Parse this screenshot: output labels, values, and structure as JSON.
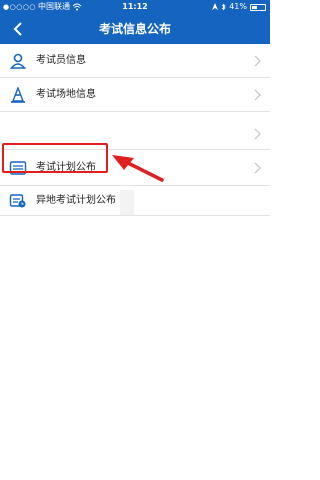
{
  "status_bar": {
    "signal": "●○○○○",
    "carrier": "中国联通",
    "time": "11:12",
    "battery": "41%",
    "battery_level": 0.41
  },
  "header": {
    "title": "考试信息公布"
  },
  "list": {
    "items": [
      {
        "label": "考试员信息",
        "icon": "person-icon"
      },
      {
        "label": "考试场地信息",
        "icon": "cone-icon"
      },
      {
        "label": "",
        "icon": ""
      },
      {
        "label": "考试计划公布",
        "icon": "calendar-list-icon"
      },
      {
        "label": "异地考试计划公布",
        "icon": "calendar-remote-icon"
      }
    ]
  },
  "colors": {
    "header_bg": "#1565c0",
    "highlight": "#e02020",
    "icon_blue": "#1565c0"
  }
}
